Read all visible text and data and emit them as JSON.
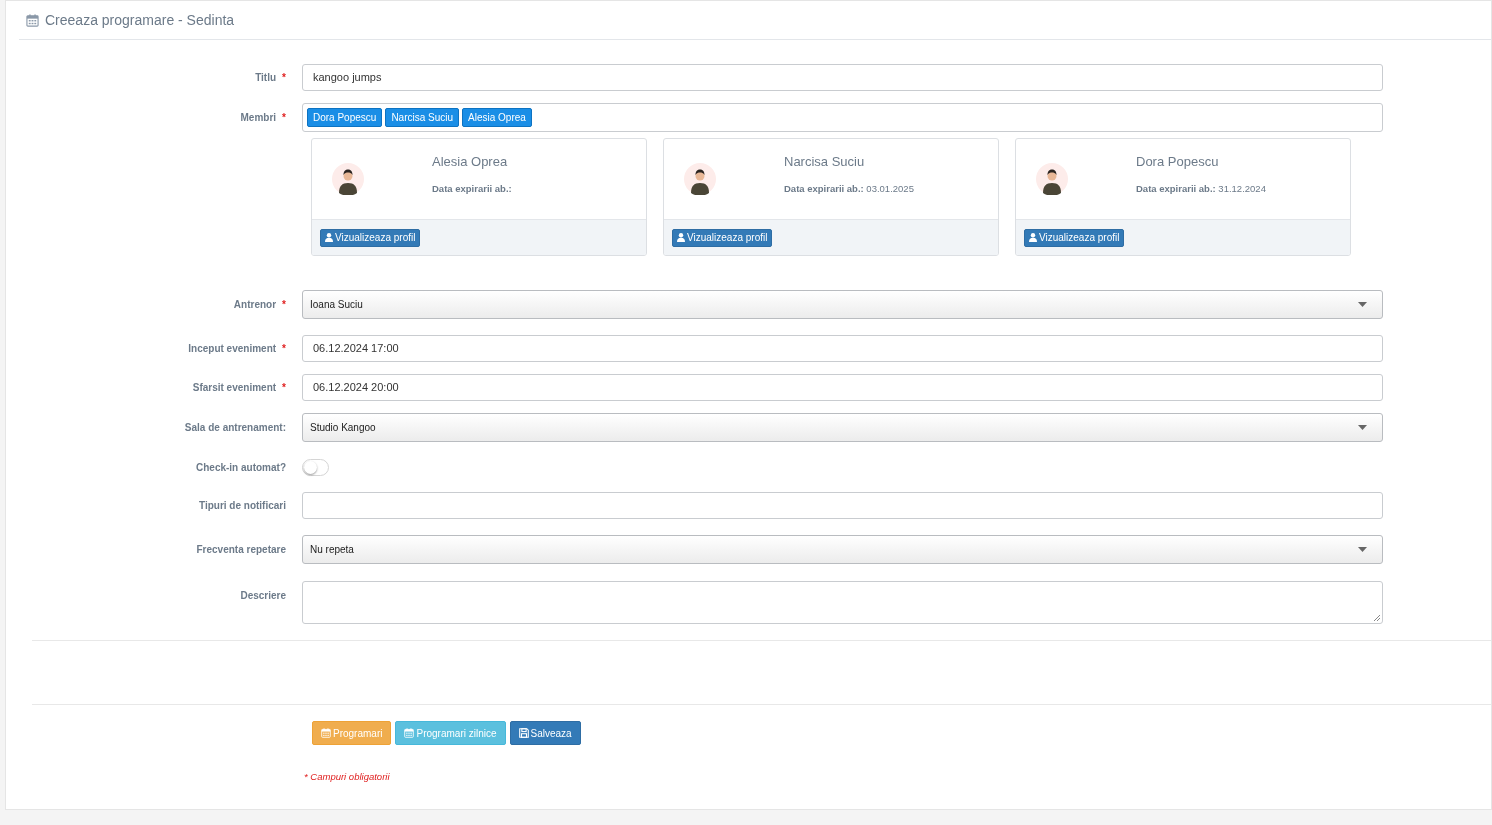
{
  "header": {
    "title": "Creeaza programare - Sedinta"
  },
  "fields": [
    {
      "kind": "text",
      "label": "Titlu",
      "required_mark": "*",
      "value": "kangoo jumps"
    },
    {
      "kind": "tags",
      "label": "Membri",
      "required_mark": "*",
      "tags": [
        "Dora Popescu",
        "Narcisa Suciu",
        "Alesia Oprea"
      ],
      "cards": [
        {
          "name": "Alesia Oprea",
          "expiry_label": "Data expirarii ab.:",
          "button": "Vizualizeaza profil"
        },
        {
          "name": "Narcisa Suciu",
          "expiry_label": "Data expirarii ab.:",
          "expiry": "03.01.2025",
          "button": "Vizualizeaza profil"
        },
        {
          "name": "Dora Popescu",
          "expiry_label": "Data expirarii ab.:",
          "expiry": "31.12.2024",
          "button": "Vizualizeaza profil"
        }
      ]
    },
    {
      "kind": "select",
      "label": "Antrenor",
      "required_mark": "*",
      "value": "Ioana Suciu"
    },
    {
      "kind": "text",
      "label": "Inceput eveniment",
      "required_mark": "*",
      "value": "06.12.2024 17:00"
    },
    {
      "kind": "text",
      "label": "Sfarsit eveniment",
      "required_mark": "*",
      "value": "06.12.2024 20:00"
    },
    {
      "kind": "select",
      "label": "Sala de antrenament:",
      "value": "Studio Kangoo"
    },
    {
      "kind": "toggle",
      "label": "Check-in automat?",
      "on": false
    },
    {
      "kind": "text",
      "label": "Tipuri de notificari"
    },
    {
      "kind": "select",
      "label": "Frecventa repetare",
      "value": "Nu repeta"
    },
    {
      "kind": "textarea",
      "label": "Descriere"
    }
  ],
  "buttons": [
    {
      "kind": "warning",
      "label": "Programari"
    },
    {
      "kind": "info",
      "label": "Programari zilnice"
    },
    {
      "kind": "primary",
      "label": "Salveaza"
    }
  ],
  "footnote": "* Campuri obligatorii"
}
